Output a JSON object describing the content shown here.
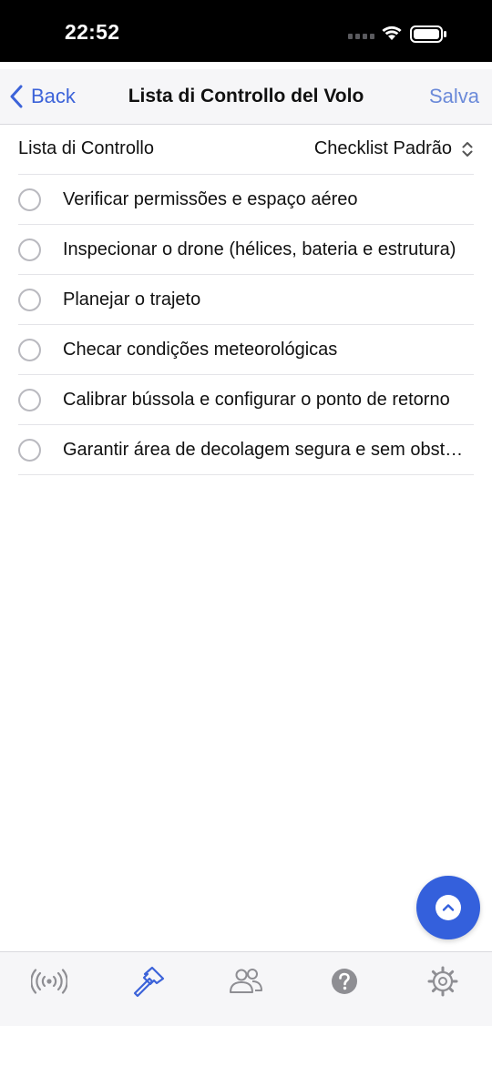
{
  "status_bar": {
    "time": "22:52"
  },
  "nav": {
    "back_label": "Back",
    "title": "Lista di Controllo del Volo",
    "save_label": "Salva"
  },
  "picker": {
    "label": "Lista di Controllo",
    "value": "Checklist Padrão"
  },
  "checklist": {
    "items": [
      {
        "label": "Verificar permissões e espaço aéreo",
        "checked": false
      },
      {
        "label": "Inspecionar o drone (hélices, bateria e estrutura)",
        "checked": false
      },
      {
        "label": "Planejar o trajeto",
        "checked": false
      },
      {
        "label": "Checar condições meteorológicas",
        "checked": false
      },
      {
        "label": "Calibrar bússola e configurar o ponto de retorno",
        "checked": false
      },
      {
        "label": "Garantir área de decolagem segura e sem obstáculos",
        "checked": false
      }
    ]
  },
  "tab_bar": {
    "tabs": [
      {
        "icon": "broadcast-icon",
        "active": false
      },
      {
        "icon": "hammer-icon",
        "active": true
      },
      {
        "icon": "people-icon",
        "active": false
      },
      {
        "icon": "question-icon",
        "active": false
      },
      {
        "icon": "gear-icon",
        "active": false
      }
    ]
  },
  "colors": {
    "accent": "#3c63d9",
    "save": "#6b8ad9",
    "fab": "#3460dc",
    "tab_inactive": "#8e8e93",
    "tab_active": "#3c63d9"
  }
}
